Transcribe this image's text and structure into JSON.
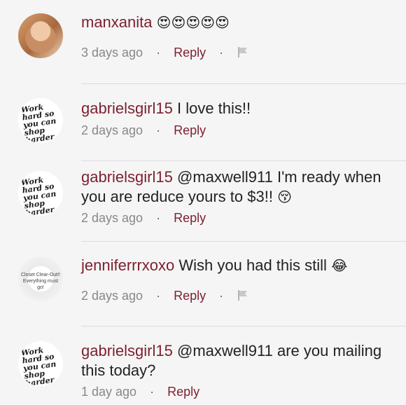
{
  "comments": [
    {
      "username": "manxanita",
      "text": "",
      "emoji": "😍😍😍😍😍",
      "time": "3 days ago",
      "reply_label": "Reply",
      "flag_icon": "flag-icon",
      "avatar_type": "photo"
    },
    {
      "username": "gabrielsgirl15",
      "text": "I love this!!",
      "emoji": "",
      "time": "2 days ago",
      "reply_label": "Reply",
      "avatar_type": "handwriting",
      "avatar_text": "Work hard so you can shop harder"
    },
    {
      "username": "gabrielsgirl15",
      "text": "@maxwell911 I'm ready when you are reduce yours to $3!!",
      "emoji": "😚",
      "time": "2 days ago",
      "reply_label": "Reply",
      "avatar_type": "handwriting",
      "avatar_text": "Work hard so you can shop harder"
    },
    {
      "username": "jenniferrrxoxo",
      "text": "Wish you had this still",
      "emoji": "😂",
      "time": "2 days ago",
      "reply_label": "Reply",
      "flag_icon": "flag-icon",
      "avatar_type": "closet",
      "avatar_text": "Closet Clear-Out!! Everything must go!"
    },
    {
      "username": "gabrielsgirl15",
      "text": "@maxwell911 are you mailing this today?",
      "emoji": "",
      "time": "1 day ago",
      "reply_label": "Reply",
      "avatar_type": "handwriting",
      "avatar_text": "Work hard so you can shop harder"
    }
  ]
}
